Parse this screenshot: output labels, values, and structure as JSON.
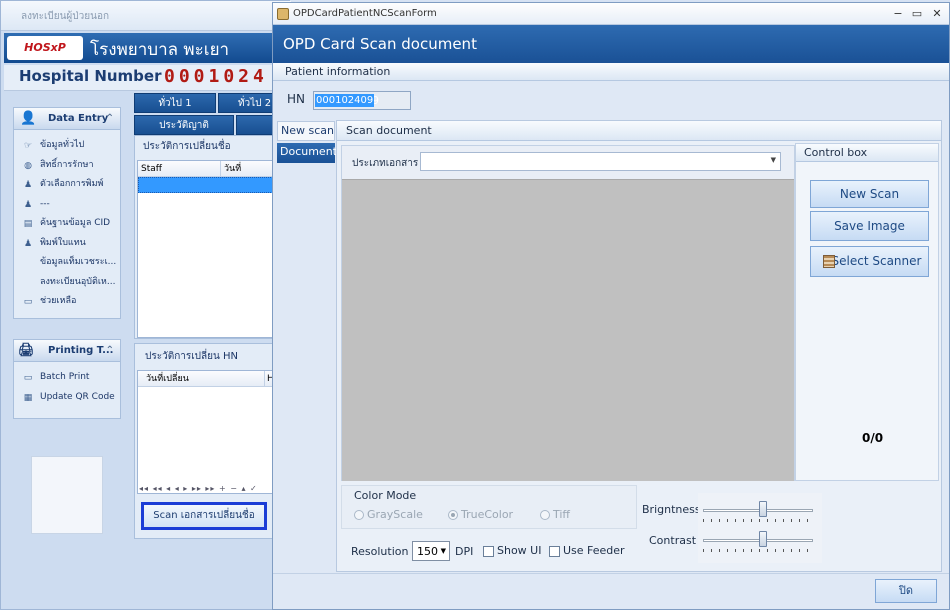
{
  "background_app": {
    "window_title": "ลงทะเบียนผู้ป่วยนอก",
    "logo_text": "HOSxP",
    "hospital_name": "โรงพยาบาล พะเยา",
    "hospital_number_label": "Hospital Number",
    "hospital_number_value": "0001024",
    "top_tabs": [
      "ทั่วไป 1",
      "ทั่วไป 2"
    ],
    "second_tabs": [
      "ประวัติญาติ",
      ""
    ],
    "data_entry_panel": {
      "title": "Data Entry",
      "items": [
        {
          "label": "ข้อมูลทั่วไป",
          "icon": "hand-icon"
        },
        {
          "label": "สิทธิ์การรักษา",
          "icon": "globe-icon"
        },
        {
          "label": "ตัวเลือกการพิมพ์",
          "icon": "people-icon"
        },
        {
          "label": "---",
          "icon": "people-icon"
        },
        {
          "label": "ค้นฐานข้อมูล CID",
          "icon": "card-icon"
        },
        {
          "label": "พิมพ์ใบแทน",
          "icon": "people-icon"
        },
        {
          "label": "ข้อมูลแท็มเวชระเ...",
          "icon": ""
        },
        {
          "label": "ลงทะเบียนอุบัติเห...",
          "icon": ""
        },
        {
          "label": "ช่วยเหลือ",
          "icon": "help-icon"
        }
      ]
    },
    "printing_panel": {
      "title": "Printing T...",
      "items": [
        {
          "label": "Batch Print",
          "icon": "print-icon"
        },
        {
          "label": "Update QR Code",
          "icon": "qr-icon"
        }
      ]
    },
    "name_history": {
      "title": "ประวัติการเปลี่ยนชื่อ",
      "columns": [
        "Staff",
        "วันที่"
      ]
    },
    "hn_history": {
      "title": "ประวัติการเปลี่ยน HN",
      "columns": [
        "วันที่เปลี่ยน",
        "H"
      ]
    },
    "nav_glyphs": "◂◂ ◂◂ ◂ ◂ ▸ ▸▸ ▸▸ + − ▴ ✓",
    "scan_button_label": "Scan เอกสารเปลี่ยนชื่อ"
  },
  "modal": {
    "window_title": "OPDCardPatientNCScanForm",
    "window_controls": [
      "−",
      "▭",
      "✕"
    ],
    "header_title": "OPD Card Scan document",
    "patient_info_label": "Patient information",
    "hn_label": "HN",
    "hn_value": "000102409",
    "side_tabs": [
      {
        "label": "New scan",
        "active": false
      },
      {
        "label": "Document",
        "active": true
      }
    ],
    "scan_document_label": "Scan document",
    "doc_type_label": "ประเภทเอกสาร",
    "doc_type_value": "",
    "control_box_label": "Control box",
    "buttons": {
      "new_scan": "New Scan",
      "save_image": "Save Image",
      "select_scanner": "Select Scanner"
    },
    "page_counter": "0/0",
    "color_mode": {
      "label": "Color Mode",
      "options": [
        {
          "label": "GrayScale",
          "selected": false
        },
        {
          "label": "TrueColor",
          "selected": true
        },
        {
          "label": "Tiff",
          "selected": false
        }
      ]
    },
    "resolution_label": "Resolution",
    "resolution_value": "150",
    "dpi_label": "DPI",
    "show_ui_label": "Show UI",
    "show_ui_checked": false,
    "use_feeder_label": "Use Feeder",
    "use_feeder_checked": false,
    "brightness_label": "Brigntness",
    "brightness_level": 0.55,
    "contrast_label": "Contrast",
    "contrast_level": 0.55,
    "close_button_label": "ปิด"
  },
  "colors": {
    "header_blue": "#1a5196",
    "digit_red": "#b11b14",
    "preview_gray": "#c0c0c0",
    "focus_border": "#1b3dd6"
  }
}
